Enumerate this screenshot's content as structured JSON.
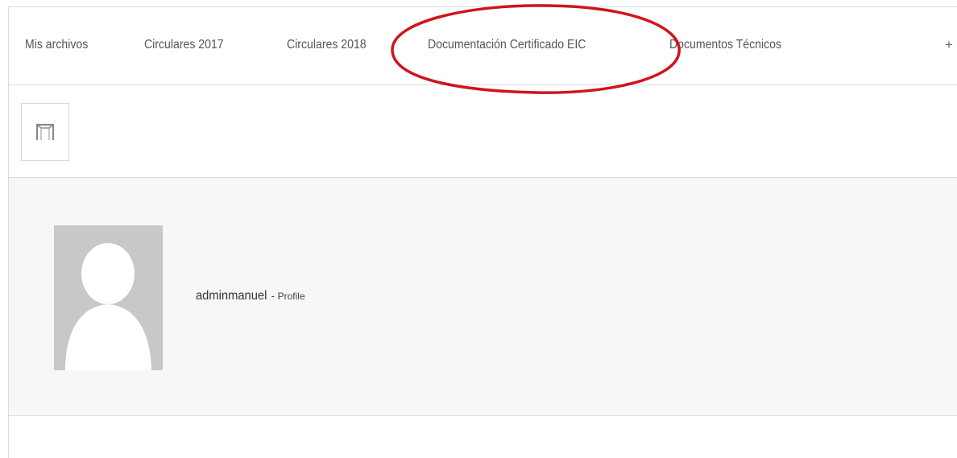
{
  "tabs": [
    {
      "label": "Mis archivos"
    },
    {
      "label": "Circulares 2017"
    },
    {
      "label": "Circulares 2018"
    },
    {
      "label": "Documentación Certificado EIC"
    },
    {
      "label": "Documentos Técnicos"
    }
  ],
  "tab_add_label": "+",
  "annotation": {
    "color": "#d0141c"
  },
  "profile": {
    "username": "adminmanuel",
    "separator": " - ",
    "profile_link": "Profile"
  },
  "icons": {
    "thumbnail": "folder-placeholder-icon",
    "avatar": "default-user-silhouette-icon"
  }
}
